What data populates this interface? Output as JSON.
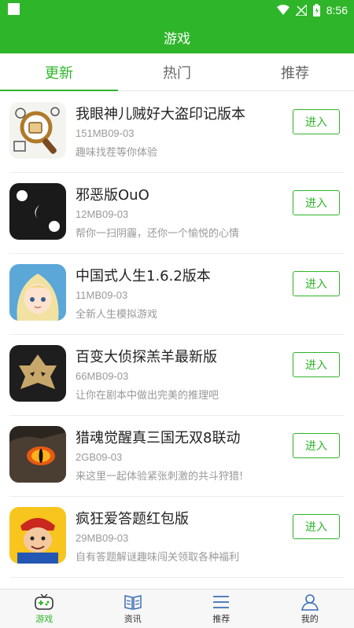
{
  "status_bar": {
    "time": "8:56"
  },
  "header": {
    "title": "游戏"
  },
  "tabs": [
    {
      "label": "更新",
      "active": true
    },
    {
      "label": "热门",
      "active": false
    },
    {
      "label": "推荐",
      "active": false
    }
  ],
  "games": [
    {
      "name": "我眼神儿贼好大盗印记版本",
      "meta": "151MB09-03",
      "desc": "趣味找茬等你体验",
      "button": "进入"
    },
    {
      "name": "邪恶版OuO",
      "meta": "12MB09-03",
      "desc": "帮你一扫阴霾，还你一个愉悦的心情",
      "button": "进入"
    },
    {
      "name": "中国式人生1.6.2版本",
      "meta": "11MB09-03",
      "desc": "全新人生模拟游戏",
      "button": "进入"
    },
    {
      "name": "百变大侦探羔羊最新版",
      "meta": "66MB09-03",
      "desc": "让你在剧本中做出完美的推理吧",
      "button": "进入"
    },
    {
      "name": "猎魂觉醒真三国无双8联动",
      "meta": "2GB09-03",
      "desc": "来这里一起体验紧张刺激的共斗狩猎!",
      "button": "进入"
    },
    {
      "name": "疯狂爱答题红包版",
      "meta": "29MB09-03",
      "desc": "自有答题解谜趣味闯关领取各种福利",
      "button": "进入"
    }
  ],
  "bottom_nav": [
    {
      "label": "游戏",
      "icon": "gamepad-icon",
      "active": true
    },
    {
      "label": "资讯",
      "icon": "book-icon",
      "active": false
    },
    {
      "label": "推荐",
      "icon": "list-icon",
      "active": false
    },
    {
      "label": "我的",
      "icon": "person-icon",
      "active": false
    }
  ],
  "colors": {
    "primary": "#2fb52a"
  }
}
